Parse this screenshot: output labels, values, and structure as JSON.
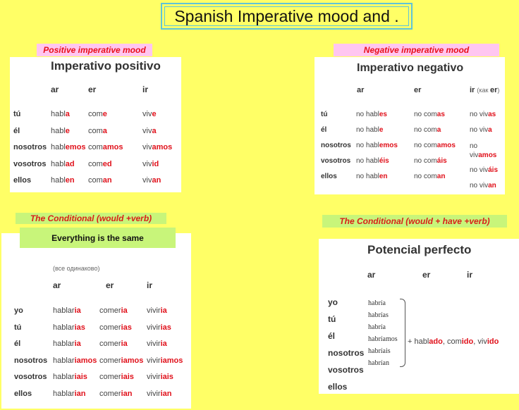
{
  "title": "Spanish Imperative mood and .",
  "positive": {
    "label": "Positive imperative mood",
    "card_title": "Imperativo positivo",
    "headers": [
      "ar",
      "er",
      "ir"
    ],
    "rows": [
      {
        "pronoun": "tú",
        "ar": [
          "habl",
          "a"
        ],
        "er": [
          "com",
          "e"
        ],
        "ir": [
          "viv",
          "e"
        ]
      },
      {
        "pronoun": "él",
        "ar": [
          "habl",
          "e"
        ],
        "er": [
          "com",
          "a"
        ],
        "ir": [
          "viv",
          "a"
        ]
      },
      {
        "pronoun": "nosotros",
        "ar": [
          "habl",
          "emos"
        ],
        "er": [
          "com",
          "amos"
        ],
        "ir": [
          "viv",
          "amos"
        ]
      },
      {
        "pronoun": "vosotros",
        "ar": [
          "habl",
          "ad"
        ],
        "er": [
          "com",
          "ed"
        ],
        "ir": [
          "viv",
          "id"
        ]
      },
      {
        "pronoun": "ellos",
        "ar": [
          "habl",
          "en"
        ],
        "er": [
          "com",
          "an"
        ],
        "ir": [
          "viv",
          "an"
        ]
      }
    ]
  },
  "negative": {
    "label": "Negative imperative mood",
    "card_title": "Imperativo negativo",
    "headers": [
      "ar",
      "er",
      "ir"
    ],
    "ir_note": "(как er)",
    "rows": [
      {
        "pronoun": "tú",
        "ar": [
          "no habl",
          "es"
        ],
        "er": [
          "no com",
          "as"
        ],
        "ir": [
          "no viv",
          "as"
        ]
      },
      {
        "pronoun": "él",
        "ar": [
          "no habl",
          "e"
        ],
        "er": [
          "no com",
          "a"
        ],
        "ir": [
          "no viv",
          "a"
        ]
      },
      {
        "pronoun": "nosotros",
        "ar": [
          "no habl",
          "emos"
        ],
        "er": [
          "no com",
          "amos"
        ],
        "ir": [
          "no viv",
          "amos"
        ]
      },
      {
        "pronoun": "vosotros",
        "ar": [
          "no habl",
          "éis"
        ],
        "er": [
          "no com",
          "áis"
        ],
        "ir": [
          "no viv",
          "áis"
        ]
      },
      {
        "pronoun": "ellos",
        "ar": [
          "no habl",
          "en"
        ],
        "er": [
          "no com",
          "an"
        ],
        "ir": [
          "no viv",
          "an"
        ]
      }
    ]
  },
  "conditional": {
    "label": "The Conditional (would +verb)",
    "overlay": "Everything is the same",
    "note": "(все одинаково)",
    "headers": [
      "ar",
      "er",
      "ir"
    ],
    "rows": [
      {
        "pronoun": "yo",
        "ar": [
          "hablar",
          "ia"
        ],
        "er": [
          "comer",
          "ia"
        ],
        "ir": [
          "vivir",
          "ia"
        ]
      },
      {
        "pronoun": "tú",
        "ar": [
          "hablar",
          "ias"
        ],
        "er": [
          "comer",
          "ias"
        ],
        "ir": [
          "vivir",
          "ias"
        ]
      },
      {
        "pronoun": "él",
        "ar": [
          "hablar",
          "ia"
        ],
        "er": [
          "comer",
          "ia"
        ],
        "ir": [
          "vivir",
          "ia"
        ]
      },
      {
        "pronoun": "nosotros",
        "ar": [
          "hablar",
          "iamos"
        ],
        "er": [
          "comer",
          "iamos"
        ],
        "ir": [
          "vivir",
          "iamos"
        ]
      },
      {
        "pronoun": "vosotros",
        "ar": [
          "hablar",
          "iais"
        ],
        "er": [
          "comer",
          "iais"
        ],
        "ir": [
          "vivir",
          "iais"
        ]
      },
      {
        "pronoun": "ellos",
        "ar": [
          "hablar",
          "ian"
        ],
        "er": [
          "comer",
          "ian"
        ],
        "ir": [
          "vivir",
          "ian"
        ]
      }
    ]
  },
  "perfect": {
    "label": "The Conditional (would + have +verb)",
    "card_title": "Potencial perfecto",
    "headers": [
      "ar",
      "er",
      "ir"
    ],
    "pronouns": [
      "yo",
      "tú",
      "él",
      "nosotros",
      "vosotros",
      "ellos"
    ],
    "auxiliaries": [
      "habría",
      "habrías",
      "habría",
      "habríamos",
      "habríais",
      "habrían"
    ],
    "participles": {
      "prefix": "+ ",
      "items": [
        [
          "habl",
          "ado"
        ],
        [
          "com",
          "ido"
        ],
        [
          "viv",
          "ido"
        ]
      ],
      "separator": ", "
    }
  }
}
